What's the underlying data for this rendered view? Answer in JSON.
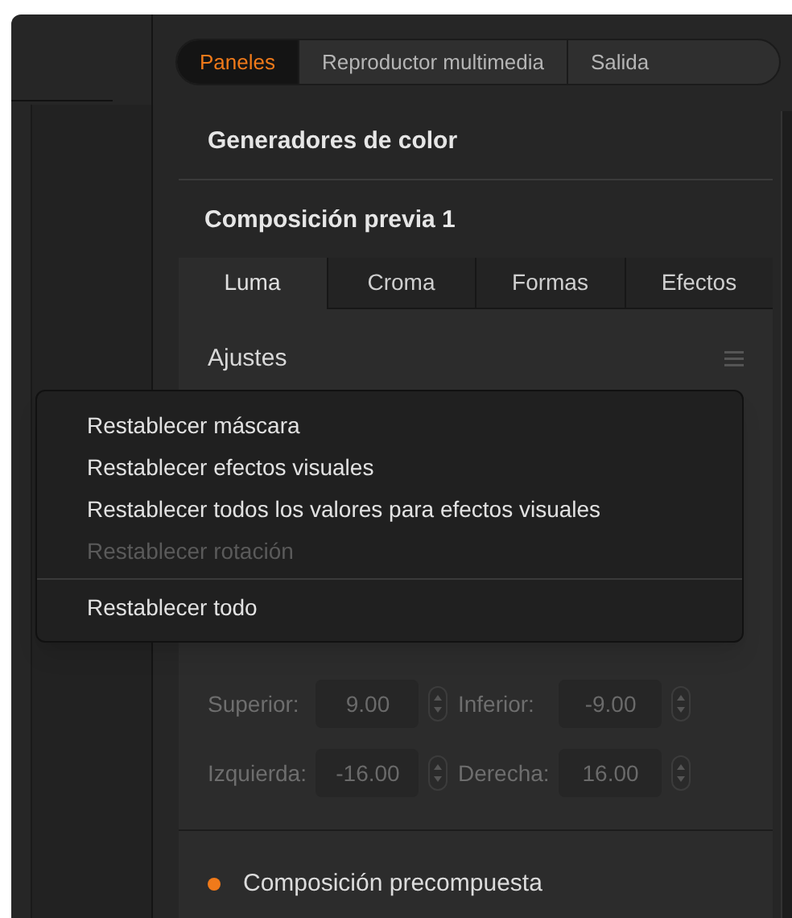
{
  "top_tabs": [
    {
      "label": "Paneles",
      "selected": true
    },
    {
      "label": "Reproductor multimedia",
      "selected": false
    },
    {
      "label": "Salida",
      "selected": false
    }
  ],
  "sections": [
    {
      "title": "Generadores de color"
    }
  ],
  "panel": {
    "title": "Composición previa 1",
    "tabs": [
      {
        "label": "Luma",
        "selected": true
      },
      {
        "label": "Croma",
        "selected": false
      },
      {
        "label": "Formas",
        "selected": false
      },
      {
        "label": "Efectos",
        "selected": false
      }
    ],
    "settings_label": "Ajustes",
    "mask_fields": [
      {
        "label": "Superior:",
        "value": "9.00",
        "disabled": true
      },
      {
        "label": "Inferior:",
        "value": "-9.00",
        "disabled": true
      },
      {
        "label": "Izquierda:",
        "value": "-16.00",
        "disabled": true
      },
      {
        "label": "Derecha:",
        "value": "16.00",
        "disabled": true
      }
    ],
    "options": [
      {
        "label": "Composición precompuesta",
        "selected": true
      }
    ]
  },
  "context_menu": [
    {
      "label": "Restablecer máscara",
      "disabled": false,
      "separator_before": false
    },
    {
      "label": "Restablecer efectos visuales",
      "disabled": false,
      "separator_before": false
    },
    {
      "label": "Restablecer todos los valores para efectos visuales",
      "disabled": false,
      "separator_before": false
    },
    {
      "label": "Restablecer rotación",
      "disabled": true,
      "separator_before": false
    },
    {
      "label": "Restablecer todo",
      "disabled": false,
      "separator_before": true
    }
  ]
}
